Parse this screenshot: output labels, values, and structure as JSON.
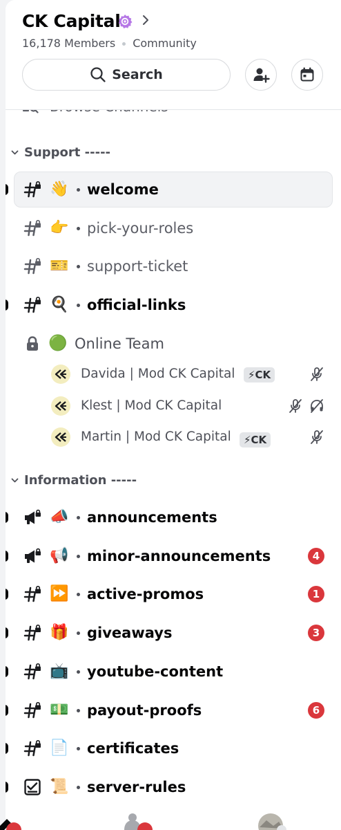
{
  "server": {
    "name": "CK Capital",
    "members": "16,178 Members",
    "type": "Community"
  },
  "header": {
    "search_label": "Search",
    "browse_label": "Browse Channels"
  },
  "icons": {
    "verified": "community-badge-icon",
    "search": "search-icon",
    "invite": "add-member-icon",
    "events": "calendar-icon",
    "hash_lock": "hashtag-lock-icon",
    "announce_lock": "megaphone-lock-icon",
    "rules": "rules-check-icon",
    "voice_lock": "padlock-icon"
  },
  "categories": [
    {
      "label": "Support -----"
    },
    {
      "label": "Information -----"
    }
  ],
  "support_channels": [
    {
      "emoji": "👋",
      "name": "welcome",
      "bold": true,
      "unread": true,
      "selected": true
    },
    {
      "emoji": "👉",
      "name": "pick-your-roles",
      "bold": false,
      "unread": false
    },
    {
      "emoji": "🎫",
      "name": "support-ticket",
      "bold": false,
      "unread": false
    },
    {
      "emoji": "🍳",
      "name": "official-links",
      "bold": true,
      "unread": true
    }
  ],
  "voice_channel": {
    "emoji": "🟢",
    "name": "Online Team"
  },
  "voice_members": [
    {
      "name": "Davida | Mod CK Capital",
      "tag": "⚡CK",
      "icons": [
        "muted-mic-icon"
      ]
    },
    {
      "name": "Klest | Mod CK Capital",
      "tag": "",
      "icons": [
        "muted-mic-icon",
        "deafened-headphones-icon"
      ]
    },
    {
      "name": "Martin | Mod CK Capital",
      "tag": "⚡CK",
      "icons": [
        "muted-mic-icon"
      ]
    }
  ],
  "information_channels": [
    {
      "type": "announce",
      "emoji": "📣",
      "name": "announcements",
      "badge": ""
    },
    {
      "type": "announce",
      "emoji": "📢",
      "name": "minor-announcements",
      "badge": "4"
    },
    {
      "type": "text",
      "emoji": "⏩",
      "name": "active-promos",
      "badge": "1"
    },
    {
      "type": "text",
      "emoji": "🎁",
      "name": "giveaways",
      "badge": "3"
    },
    {
      "type": "text",
      "emoji": "📺",
      "name": "youtube-content",
      "badge": ""
    },
    {
      "type": "text",
      "emoji": "💵",
      "name": "payout-proofs",
      "badge": "6"
    },
    {
      "type": "text",
      "emoji": "📄",
      "name": "certificates",
      "badge": ""
    },
    {
      "type": "rules",
      "emoji": "📜",
      "name": "server-rules",
      "badge": ""
    }
  ],
  "colors": {
    "accent_purple": "#b678e6",
    "badge_red": "#da373c",
    "text_primary": "#060607",
    "text_muted": "#5c5e66"
  }
}
